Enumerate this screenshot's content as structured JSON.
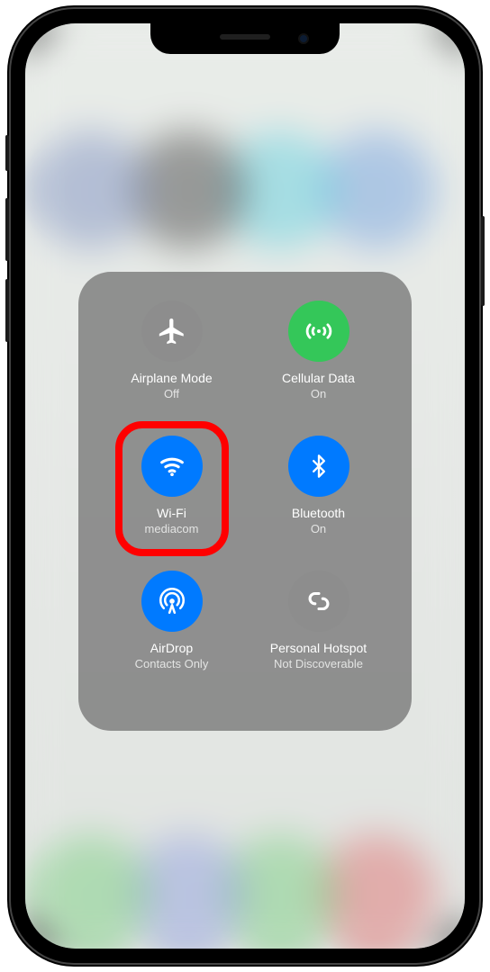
{
  "toggles": {
    "airplane": {
      "title": "Airplane Mode",
      "status": "Off"
    },
    "cellular": {
      "title": "Cellular Data",
      "status": "On"
    },
    "wifi": {
      "title": "Wi-Fi",
      "status": "mediacom"
    },
    "bluetooth": {
      "title": "Bluetooth",
      "status": "On"
    },
    "airdrop": {
      "title": "AirDrop",
      "status": "Contacts Only"
    },
    "hotspot": {
      "title": "Personal Hotspot",
      "status": "Not Discoverable"
    }
  }
}
